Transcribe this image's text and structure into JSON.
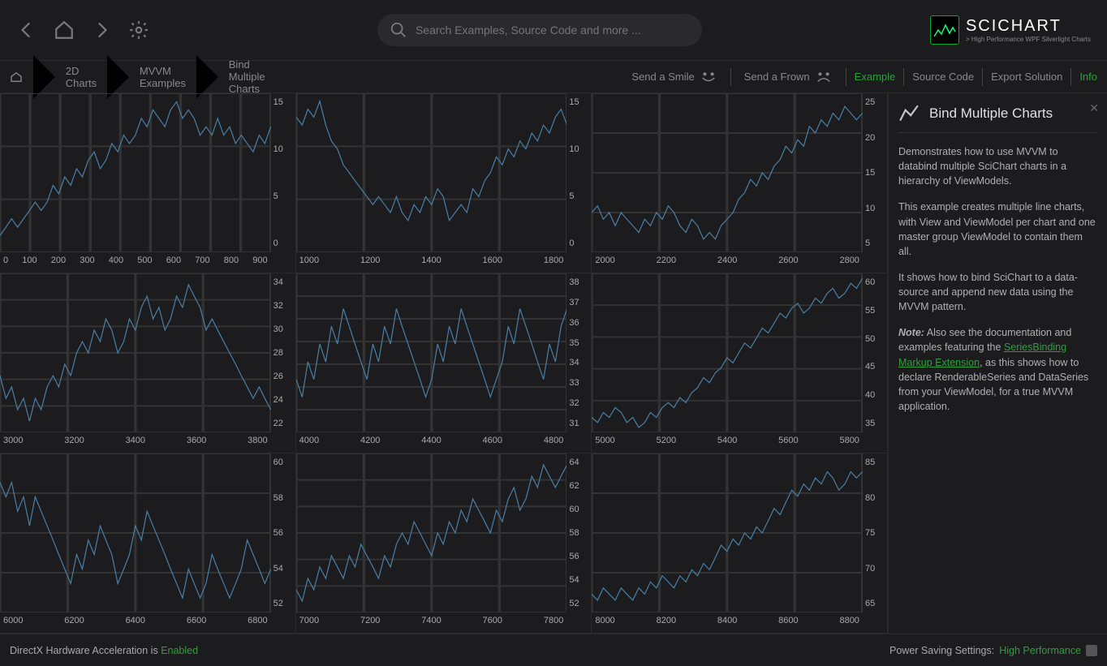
{
  "search": {
    "placeholder": "Search Examples, Source Code and more ..."
  },
  "brand": {
    "name": "SCICHART",
    "tagline": "> High Performance WPF Silverlight Charts"
  },
  "breadcrumb": [
    "2D Charts",
    "MVVM Examples",
    "Bind Multiple Charts"
  ],
  "feedback": {
    "smile": "Send a Smile",
    "frown": "Send a Frown"
  },
  "tabs": {
    "example": "Example",
    "source": "Source Code",
    "export": "Export Solution",
    "info": "Info"
  },
  "info": {
    "title": "Bind Multiple Charts",
    "p1": "Demonstrates how to use MVVM to databind multiple SciChart charts in a hierarchy of ViewModels.",
    "p2": "This example creates multiple line charts, with View and ViewModel per chart and one master group ViewModel to contain them all.",
    "p3": "It shows how to bind SciChart to a data-source and append new data using the MVVM pattern.",
    "note_label": "Note:",
    "p4a": " Also see the documentation and examples featuring the ",
    "p4link": "SeriesBinding Markup Extension",
    "p4b": ", as this shows how to declare RenderableSeries and DataSeries from your ViewModel, for a true MVVM application."
  },
  "status": {
    "dx_label": "DirectX Hardware Acceleration is ",
    "dx_state": "Enabled",
    "ps_label": "Power Saving Settings: ",
    "ps_state": "High Performance"
  },
  "chart_data": [
    {
      "type": "line",
      "xlim": [
        0,
        900
      ],
      "ylim": [
        -2,
        17
      ],
      "xticks": [
        0,
        100,
        200,
        300,
        400,
        500,
        600,
        700,
        800,
        900
      ],
      "yticks": [
        15,
        10,
        5,
        0
      ],
      "values": [
        0,
        1,
        2,
        1,
        2,
        3,
        4,
        3,
        4,
        6,
        5,
        7,
        6,
        8,
        7,
        9,
        10,
        8,
        9,
        11,
        10,
        12,
        11,
        12,
        14,
        13,
        15,
        14,
        13,
        15,
        16,
        14,
        15,
        14,
        12,
        13,
        12,
        14,
        12,
        13,
        11,
        12,
        11,
        10,
        12,
        11,
        13
      ]
    },
    {
      "type": "line",
      "xlim": [
        1000,
        1900
      ],
      "ylim": [
        -2,
        18
      ],
      "xticks": [
        1000,
        1200,
        1400,
        1600,
        1800
      ],
      "yticks": [
        15,
        10,
        5,
        0
      ],
      "values": [
        15,
        14,
        16,
        15,
        17,
        14,
        12,
        11,
        9,
        8,
        7,
        6,
        5,
        4,
        5,
        4,
        3,
        5,
        3,
        2,
        4,
        3,
        5,
        4,
        6,
        5,
        2,
        3,
        4,
        3,
        6,
        5,
        7,
        8,
        10,
        9,
        11,
        10,
        12,
        11,
        13,
        12,
        14,
        13,
        15,
        16,
        14
      ]
    },
    {
      "type": "line",
      "xlim": [
        2000,
        2900
      ],
      "ylim": [
        4,
        28
      ],
      "xticks": [
        2000,
        2200,
        2400,
        2600,
        2800
      ],
      "yticks": [
        25,
        20,
        15,
        10,
        5
      ],
      "values": [
        10,
        11,
        9,
        10,
        8,
        10,
        9,
        8,
        7,
        9,
        8,
        10,
        9,
        11,
        10,
        8,
        7,
        9,
        8,
        6,
        7,
        6,
        8,
        9,
        10,
        12,
        13,
        15,
        14,
        16,
        15,
        17,
        18,
        20,
        19,
        21,
        20,
        23,
        22,
        24,
        23,
        25,
        24,
        26,
        25,
        24,
        25
      ]
    },
    {
      "type": "line",
      "xlim": [
        3000,
        3900
      ],
      "ylim": [
        21,
        35
      ],
      "xticks": [
        3000,
        3200,
        3400,
        3600,
        3800
      ],
      "yticks": [
        34,
        32,
        30,
        28,
        26,
        24,
        22
      ],
      "values": [
        26,
        24,
        25,
        23,
        24,
        22,
        24,
        23,
        25,
        26,
        25,
        27,
        26,
        28,
        29,
        28,
        30,
        29,
        31,
        30,
        28,
        29,
        31,
        30,
        32,
        33,
        31,
        32,
        30,
        31,
        33,
        32,
        34,
        33,
        32,
        30,
        31,
        30,
        29,
        28,
        27,
        26,
        25,
        24,
        25,
        24,
        23
      ]
    },
    {
      "type": "line",
      "xlim": [
        4000,
        4900
      ],
      "ylim": [
        30,
        39
      ],
      "xticks": [
        4000,
        4200,
        4400,
        4600,
        4800
      ],
      "yticks": [
        38,
        37,
        36,
        35,
        34,
        33,
        32,
        31
      ],
      "values": [
        33,
        32,
        34,
        33,
        35,
        34,
        36,
        35,
        37,
        36,
        35,
        34,
        33,
        35,
        34,
        36,
        35,
        37,
        36,
        35,
        34,
        33,
        32,
        33,
        35,
        34,
        36,
        35,
        37,
        36,
        35,
        34,
        33,
        32,
        33,
        34,
        36,
        35,
        37,
        36,
        35,
        34,
        33,
        35,
        34,
        36,
        37
      ]
    },
    {
      "type": "line",
      "xlim": [
        5000,
        5900
      ],
      "ylim": [
        30,
        62
      ],
      "xticks": [
        5000,
        5200,
        5400,
        5600,
        5800
      ],
      "yticks": [
        60,
        55,
        50,
        45,
        40,
        35
      ],
      "values": [
        33,
        32,
        34,
        33,
        35,
        34,
        32,
        33,
        31,
        32,
        34,
        33,
        35,
        36,
        35,
        37,
        36,
        38,
        39,
        41,
        40,
        42,
        43,
        45,
        44,
        46,
        48,
        47,
        49,
        51,
        50,
        52,
        54,
        53,
        55,
        56,
        54,
        55,
        57,
        56,
        58,
        59,
        57,
        58,
        60,
        59,
        61
      ]
    },
    {
      "type": "line",
      "xlim": [
        6000,
        6900
      ],
      "ylim": [
        51,
        62
      ],
      "xticks": [
        6000,
        6200,
        6400,
        6600,
        6800
      ],
      "yticks": [
        60,
        58,
        56,
        54,
        52
      ],
      "values": [
        60,
        59,
        60,
        58,
        59,
        57,
        59,
        58,
        57,
        56,
        55,
        54,
        53,
        55,
        54,
        56,
        55,
        57,
        56,
        55,
        53,
        54,
        55,
        57,
        56,
        58,
        57,
        56,
        55,
        54,
        53,
        52,
        54,
        53,
        52,
        53,
        55,
        54,
        53,
        52,
        53,
        54,
        56,
        55,
        54,
        53,
        54
      ]
    },
    {
      "type": "line",
      "xlim": [
        7000,
        7900
      ],
      "ylim": [
        51,
        65
      ],
      "xticks": [
        7000,
        7200,
        7400,
        7600,
        7800
      ],
      "yticks": [
        64,
        62,
        60,
        58,
        56,
        54,
        52
      ],
      "values": [
        53,
        52,
        54,
        53,
        55,
        54,
        56,
        55,
        54,
        56,
        55,
        57,
        56,
        55,
        54,
        56,
        55,
        57,
        58,
        57,
        59,
        58,
        57,
        56,
        58,
        57,
        59,
        58,
        60,
        59,
        61,
        60,
        59,
        58,
        60,
        59,
        61,
        62,
        60,
        61,
        63,
        62,
        64,
        63,
        62,
        63,
        64
      ]
    },
    {
      "type": "line",
      "xlim": [
        8000,
        8900
      ],
      "ylim": [
        62,
        88
      ],
      "xticks": [
        8000,
        8200,
        8400,
        8600,
        8800
      ],
      "yticks": [
        85,
        80,
        75,
        70,
        65
      ],
      "values": [
        65,
        64,
        66,
        65,
        64,
        66,
        65,
        64,
        66,
        65,
        67,
        66,
        68,
        67,
        66,
        68,
        67,
        69,
        68,
        70,
        69,
        71,
        73,
        72,
        74,
        73,
        75,
        74,
        76,
        75,
        77,
        79,
        78,
        80,
        82,
        81,
        83,
        82,
        84,
        83,
        85,
        84,
        82,
        83,
        85,
        84,
        85
      ]
    }
  ]
}
